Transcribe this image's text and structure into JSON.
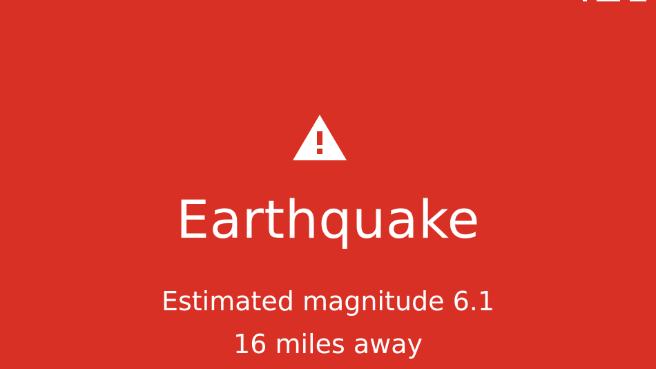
{
  "alert": {
    "icon": "warning-triangle-icon",
    "title": "Earthquake",
    "magnitude_text": "Estimated magnitude 6.1",
    "distance_text": "16 miles away"
  },
  "colors": {
    "background": "#d93025",
    "foreground": "#ffffff"
  }
}
